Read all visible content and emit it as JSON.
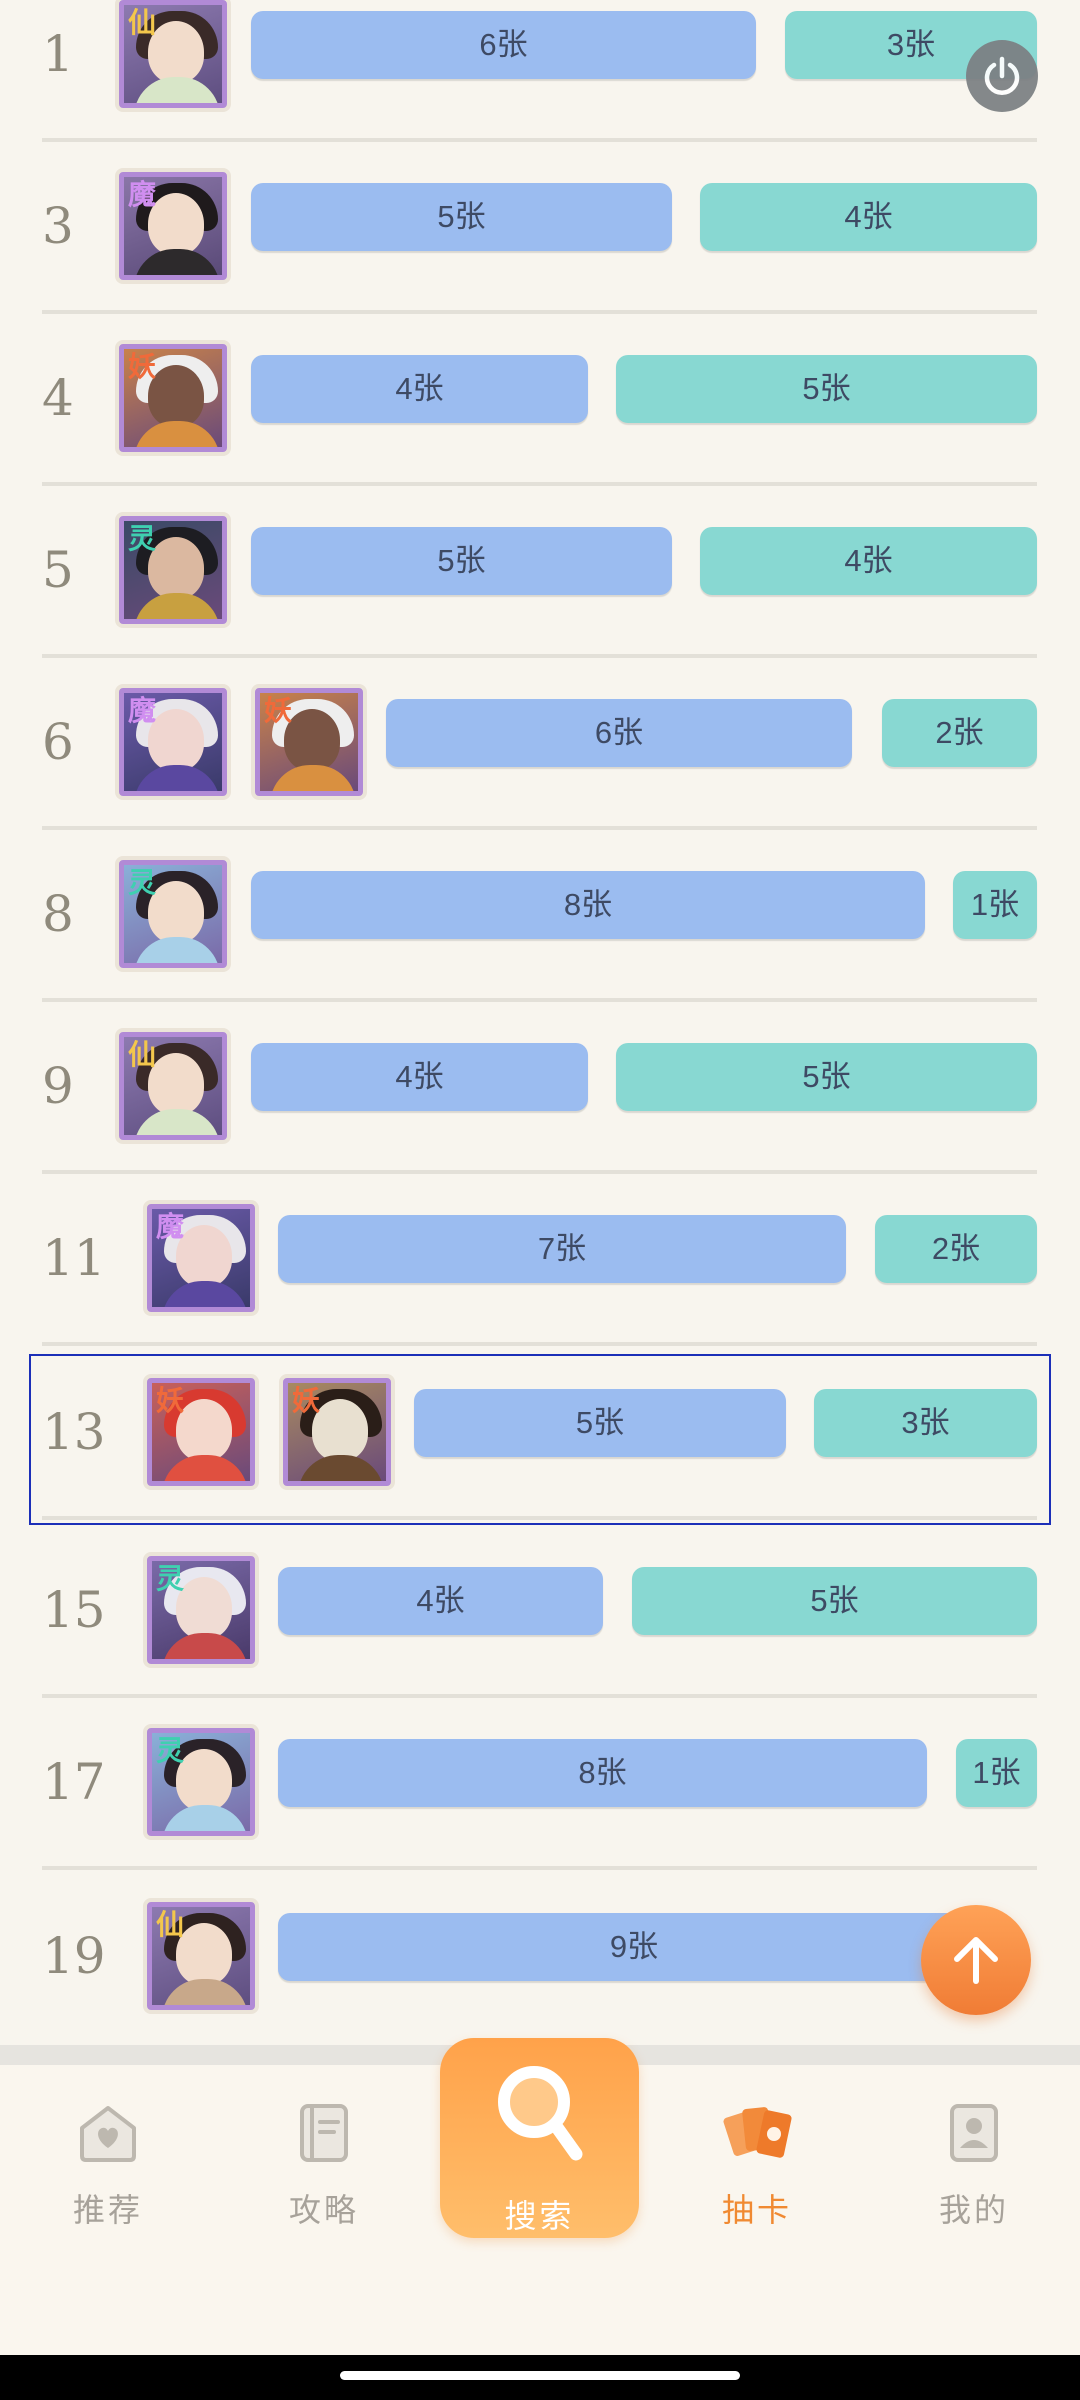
{
  "rows": [
    {
      "rank": "1",
      "tags": [
        "仙"
      ],
      "bars": [
        "6张",
        "3张"
      ]
    },
    {
      "rank": "3",
      "tags": [
        "魔"
      ],
      "bars": [
        "5张",
        "4张"
      ]
    },
    {
      "rank": "4",
      "tags": [
        "妖"
      ],
      "bars": [
        "4张",
        "5张"
      ]
    },
    {
      "rank": "5",
      "tags": [
        "灵"
      ],
      "bars": [
        "5张",
        "4张"
      ]
    },
    {
      "rank": "6",
      "tags": [
        "魔",
        "妖"
      ],
      "bars": [
        "6张",
        "2张"
      ]
    },
    {
      "rank": "8",
      "tags": [
        "灵"
      ],
      "bars": [
        "8张",
        "1张"
      ]
    },
    {
      "rank": "9",
      "tags": [
        "仙"
      ],
      "bars": [
        "4张",
        "5张"
      ]
    },
    {
      "rank": "11",
      "tags": [
        "魔"
      ],
      "bars": [
        "7张",
        "2张"
      ]
    },
    {
      "rank": "13",
      "tags": [
        "妖",
        "妖"
      ],
      "bars": [
        "5张",
        "3张"
      ]
    },
    {
      "rank": "15",
      "tags": [
        "灵"
      ],
      "bars": [
        "4张",
        "5张"
      ]
    },
    {
      "rank": "17",
      "tags": [
        "灵"
      ],
      "bars": [
        "8张",
        "1张"
      ]
    },
    {
      "rank": "19",
      "tags": [
        "仙"
      ],
      "bars": [
        "9张"
      ]
    }
  ],
  "nav": {
    "recommend": "推荐",
    "guide": "攻略",
    "search": "搜索",
    "draw": "抽卡",
    "mine": "我的"
  },
  "icons": {
    "power": "power-icon",
    "scroll_top": "arrow-up-icon"
  },
  "colors": {
    "accent": "#f08a32",
    "bar_blue": "#9bbcf0",
    "bar_teal": "#88d8d2",
    "avatar_border": "#b18ad6",
    "selection": "#1c2fb8"
  }
}
